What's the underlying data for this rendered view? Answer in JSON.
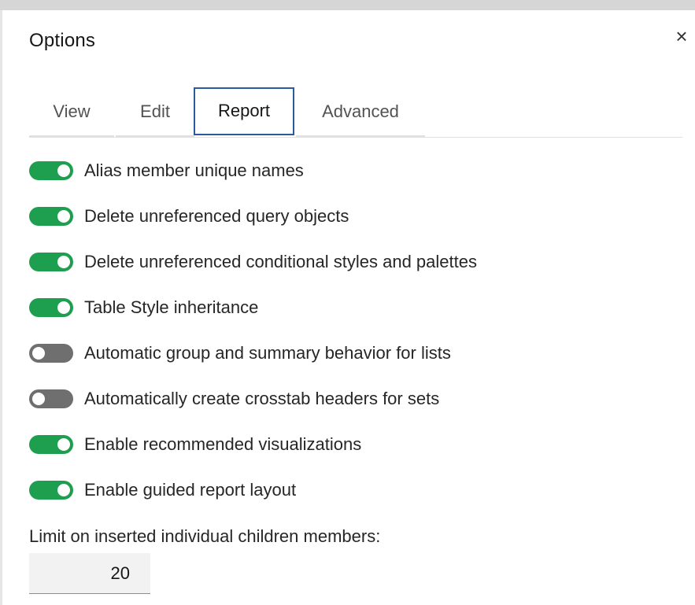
{
  "dialog": {
    "title": "Options",
    "close_glyph": "×"
  },
  "tabs": [
    {
      "label": "View",
      "active": false
    },
    {
      "label": "Edit",
      "active": false
    },
    {
      "label": "Report",
      "active": true
    },
    {
      "label": "Advanced",
      "active": false
    }
  ],
  "toggles": [
    {
      "label": "Alias member unique names",
      "on": true
    },
    {
      "label": "Delete unreferenced query objects",
      "on": true
    },
    {
      "label": "Delete unreferenced conditional styles and palettes",
      "on": true
    },
    {
      "label": "Table Style inheritance",
      "on": true
    },
    {
      "label": "Automatic group and summary behavior for lists",
      "on": false
    },
    {
      "label": "Automatically create crosstab headers for sets",
      "on": false
    },
    {
      "label": "Enable recommended visualizations",
      "on": true
    },
    {
      "label": "Enable guided report layout",
      "on": true
    }
  ],
  "limit": {
    "label": "Limit on inserted individual children members:",
    "value": "20"
  },
  "colors": {
    "toggle_on": "#1e9e4f",
    "toggle_off": "#6f6f6f",
    "active_tab_border": "#2c5aa0"
  },
  "icons": {
    "close": "close-icon"
  }
}
